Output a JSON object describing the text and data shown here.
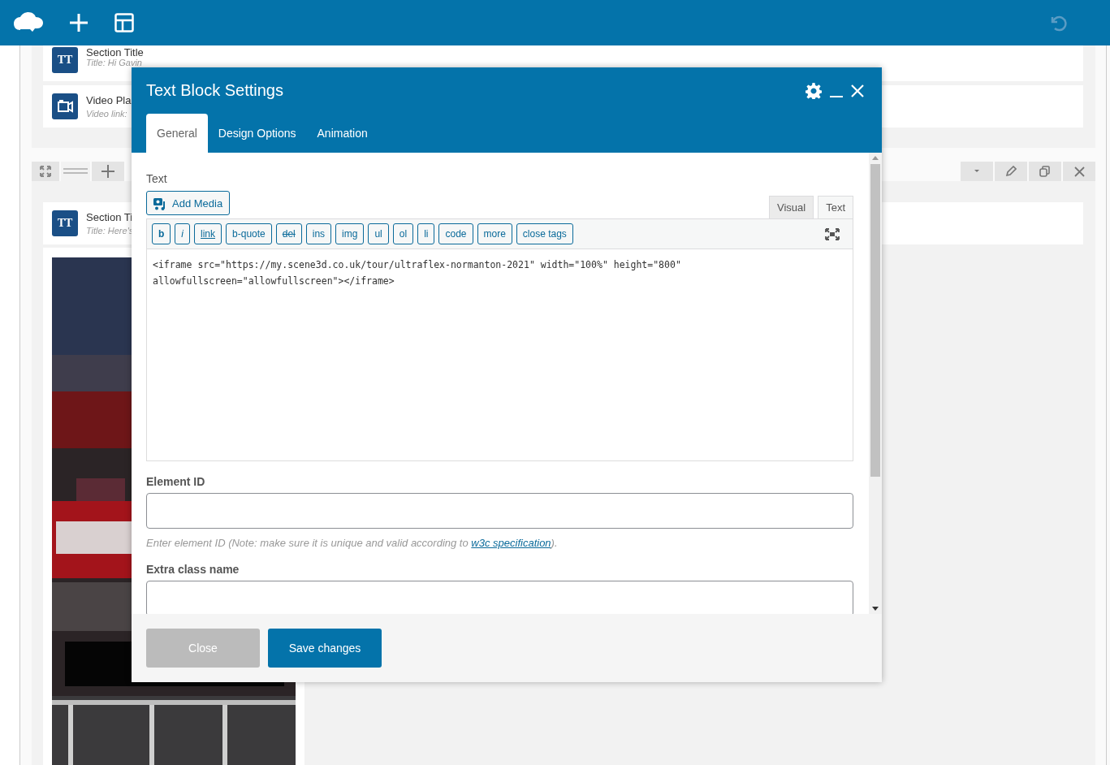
{
  "builder": {
    "rows": [
      {
        "elements": [
          {
            "kind": "title",
            "badge": "TT",
            "title": "Section Title",
            "subtitle": "Title: Hi Gavin"
          },
          {
            "kind": "video",
            "title": "Video Pla",
            "subtitle": "Video link:"
          }
        ]
      },
      {
        "elements": [
          {
            "kind": "title",
            "badge": "TT",
            "title": "Section Ti",
            "subtitle": "Title: Here's"
          },
          {
            "kind": "picture"
          }
        ]
      }
    ]
  },
  "dialog": {
    "title": "Text Block Settings",
    "tabs": [
      {
        "label": "General",
        "selected": true
      },
      {
        "label": "Design Options",
        "selected": false
      },
      {
        "label": "Animation",
        "selected": false
      }
    ],
    "editor": {
      "label": "Text",
      "add_media": "Add Media",
      "modes": [
        {
          "label": "Visual",
          "selected": false
        },
        {
          "label": "Text",
          "selected": true
        }
      ],
      "quicktags": [
        {
          "label": "b",
          "kind": "bold"
        },
        {
          "label": "i",
          "kind": "italic"
        },
        {
          "label": "link",
          "kind": "link"
        },
        {
          "label": "b-quote",
          "kind": "plain"
        },
        {
          "label": "del",
          "kind": "strike"
        },
        {
          "label": "ins",
          "kind": "plain"
        },
        {
          "label": "img",
          "kind": "plain"
        },
        {
          "label": "ul",
          "kind": "plain"
        },
        {
          "label": "ol",
          "kind": "plain"
        },
        {
          "label": "li",
          "kind": "plain"
        },
        {
          "label": "code",
          "kind": "plain"
        },
        {
          "label": "more",
          "kind": "plain"
        },
        {
          "label": "close tags",
          "kind": "plain"
        }
      ],
      "content": "<iframe src=\"https://my.scene3d.co.uk/tour/ultraflex-normanton-2021\" width=\"100%\" height=\"800\" allowfullscreen=\"allowfullscreen\"></iframe>"
    },
    "element_id": {
      "label": "Element ID",
      "hint_before": "Enter element ID (Note: make sure it is unique and valid according to ",
      "hint_link": "w3c specification",
      "hint_after": ")."
    },
    "extra_class": {
      "label": "Extra class name"
    },
    "buttons": [
      {
        "label": "Close",
        "kind": "secondary"
      },
      {
        "label": "Save changes",
        "kind": "primary"
      }
    ]
  }
}
